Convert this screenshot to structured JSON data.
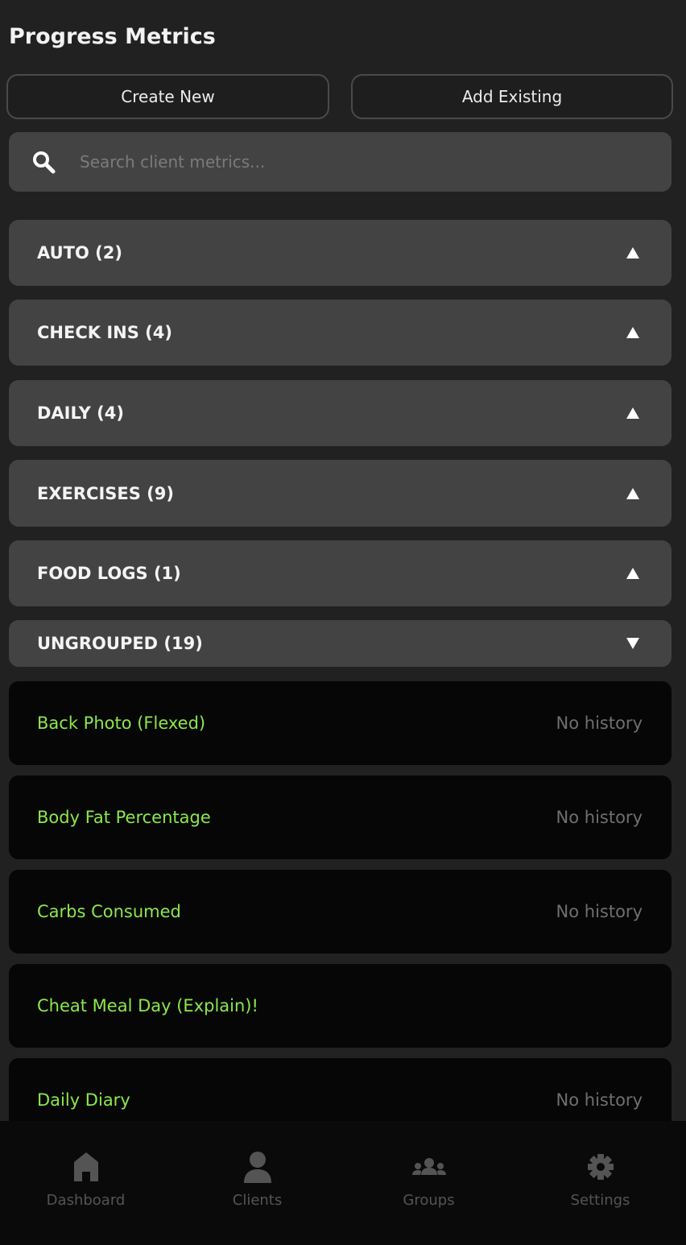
{
  "header": {
    "title": "Progress Metrics"
  },
  "actions": {
    "create_label": "Create New",
    "add_label": "Add Existing"
  },
  "search": {
    "placeholder": "Search client metrics..."
  },
  "groups": [
    {
      "label": "AUTO (2)",
      "expanded": false
    },
    {
      "label": "CHECK INS (4)",
      "expanded": false
    },
    {
      "label": "DAILY (4)",
      "expanded": false
    },
    {
      "label": "EXERCISES (9)",
      "expanded": false
    },
    {
      "label": "FOOD LOGS (1)",
      "expanded": false
    },
    {
      "label": "UNGROUPED (19)",
      "expanded": true
    }
  ],
  "metrics": [
    {
      "name": "Back Photo (Flexed)",
      "history": "No history"
    },
    {
      "name": "Body Fat Percentage",
      "history": "No history"
    },
    {
      "name": "Carbs Consumed",
      "history": "No history"
    },
    {
      "name": "Cheat Meal Day (Explain)!",
      "history": ""
    },
    {
      "name": "Daily Diary",
      "history": "No history"
    }
  ],
  "tabs": [
    {
      "label": "Dashboard",
      "icon": "home-icon"
    },
    {
      "label": "Clients",
      "icon": "person-icon"
    },
    {
      "label": "Groups",
      "icon": "group-icon"
    },
    {
      "label": "Settings",
      "icon": "gear-icon"
    }
  ],
  "colors": {
    "background": "#212121",
    "card": "#434343",
    "metric_card": "#060606",
    "accent_green": "#8be84d",
    "muted_text": "#6f6f6f",
    "tab_inactive": "#545454"
  }
}
